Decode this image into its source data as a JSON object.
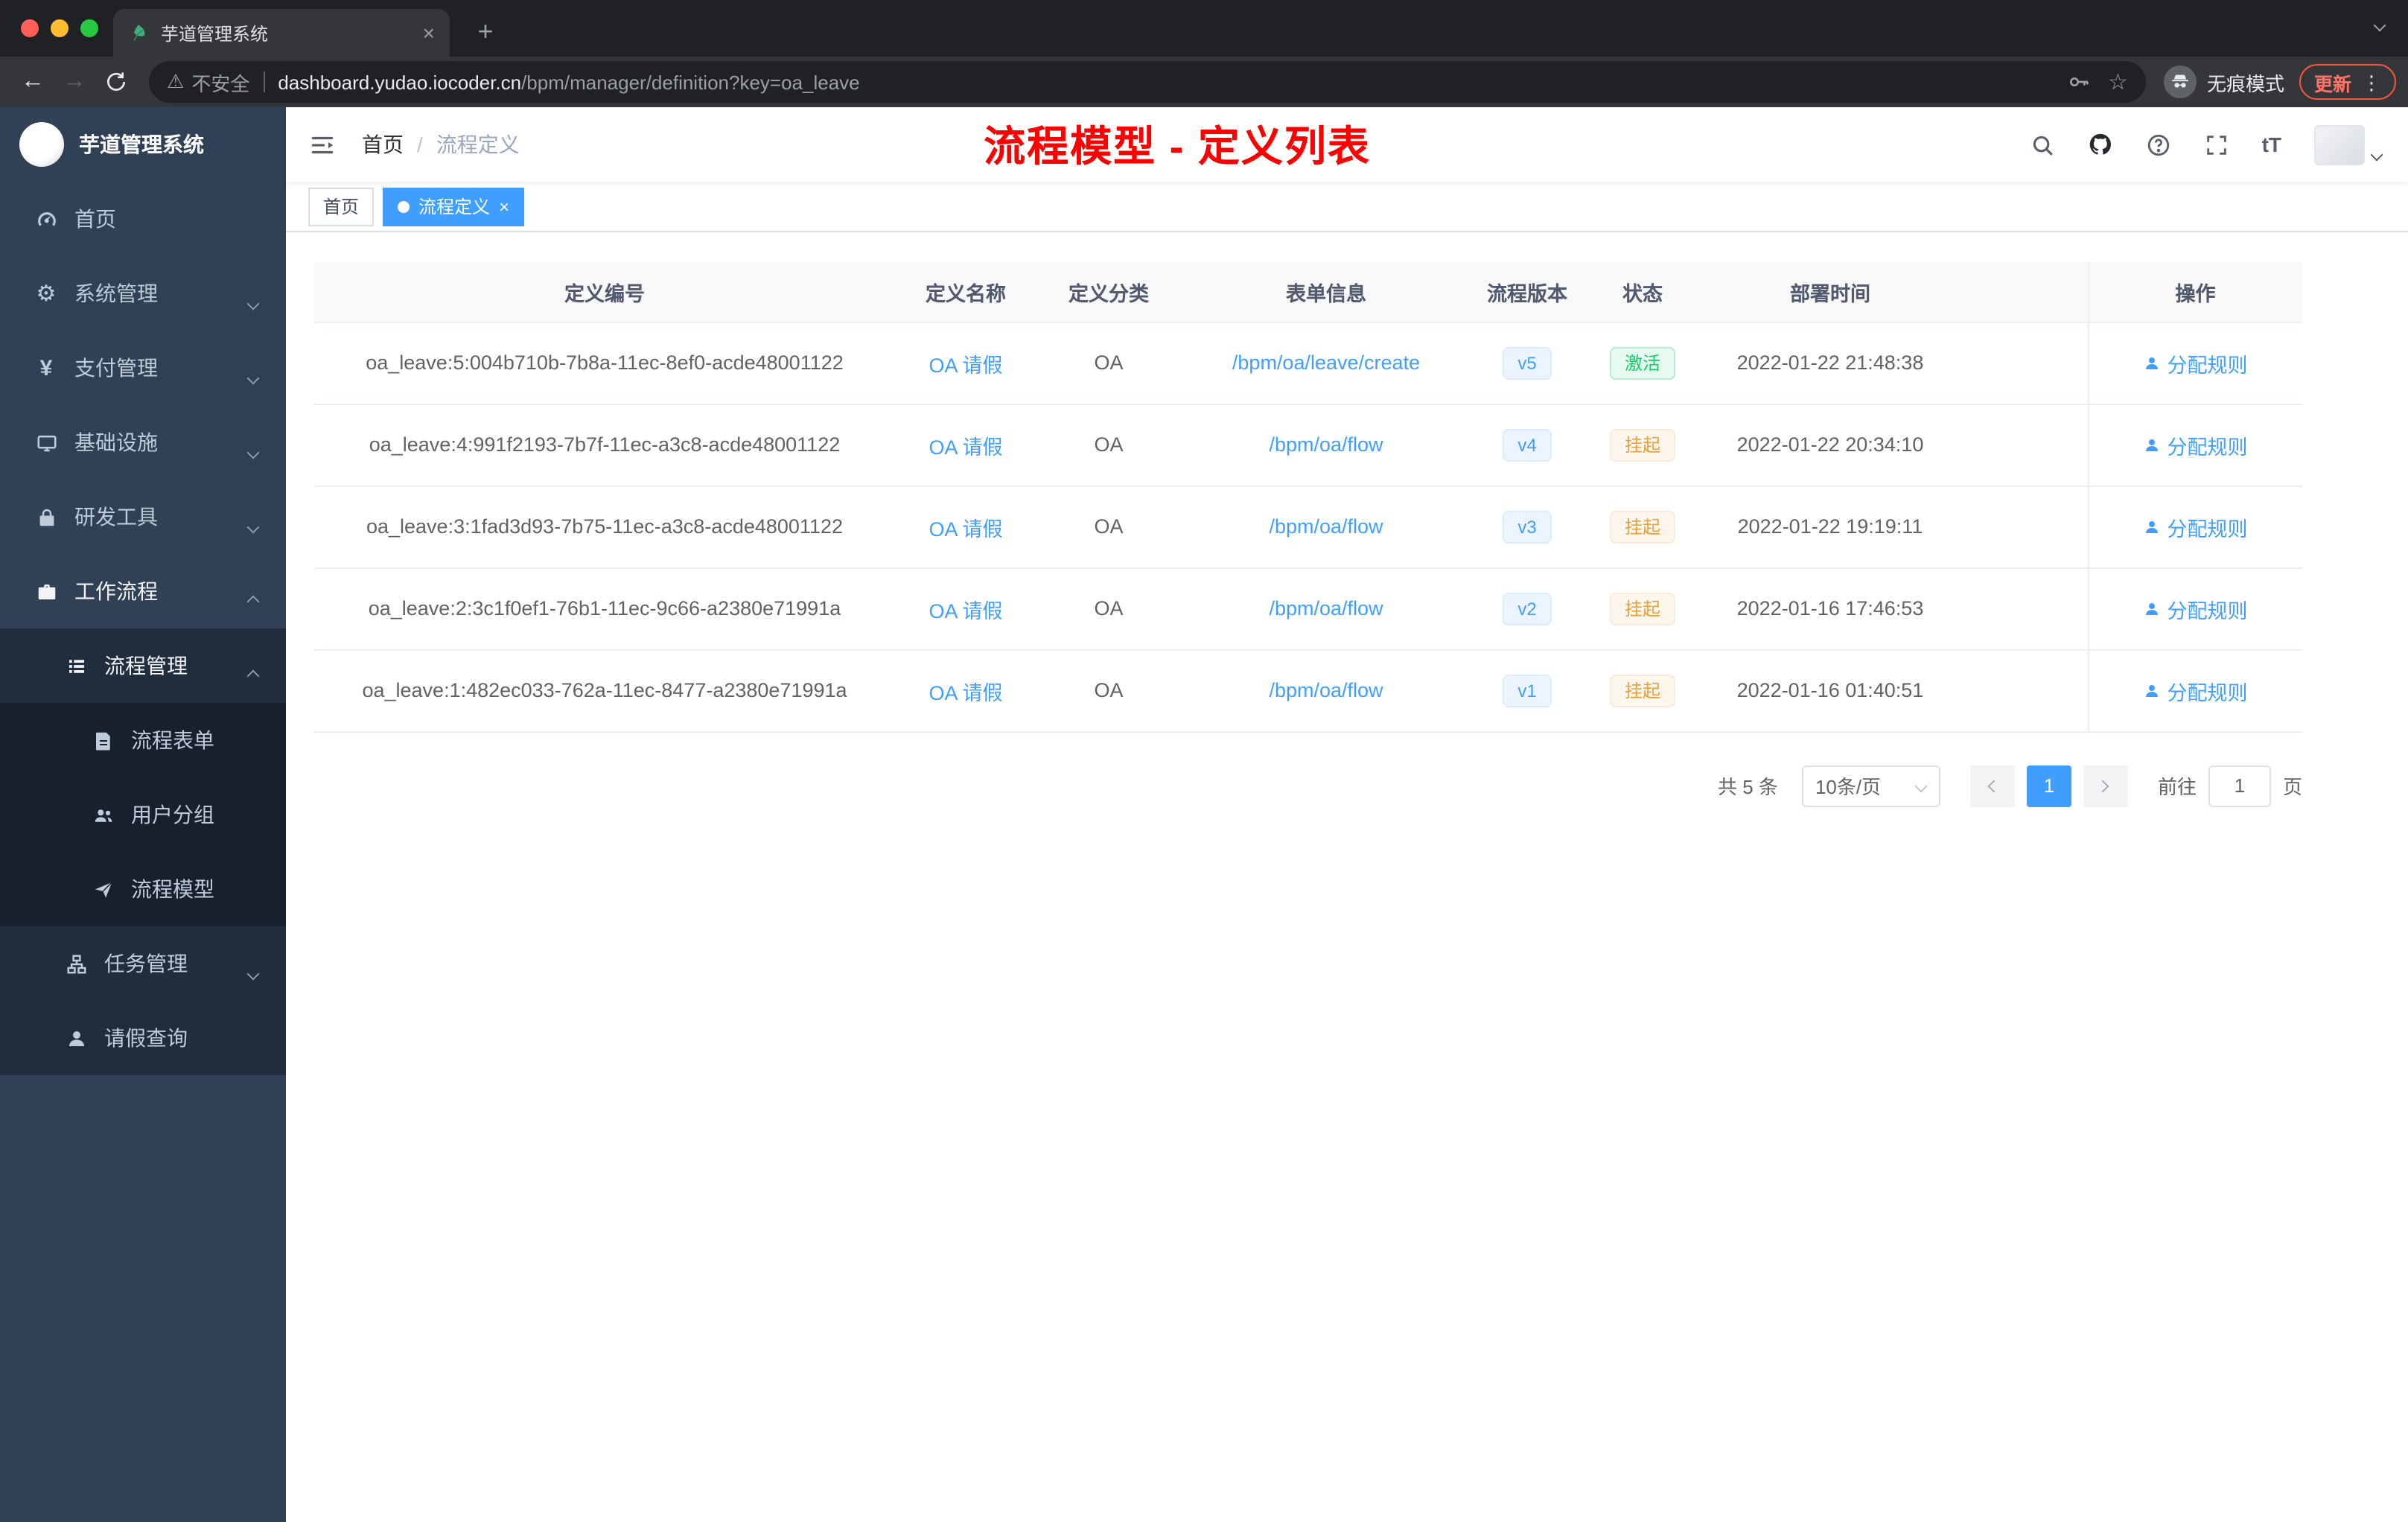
{
  "browser": {
    "tab": {
      "title": "芋道管理系统",
      "close": "×",
      "new_tab": "+"
    },
    "toolbar": {
      "back": "←",
      "forward": "→",
      "security_label": "不安全",
      "warning_glyph": "⚠",
      "url_domain": "dashboard.yudao.iocoder.cn",
      "url_path": "/bpm/manager/definition?key=oa_leave",
      "star": "☆",
      "incognito_label": "无痕模式",
      "update_label": "更新",
      "menu_dots": "⋮"
    }
  },
  "sidebar": {
    "app_title": "芋道管理系统",
    "items": [
      {
        "label": "首页",
        "icon": "dashboard-icon",
        "level": 0,
        "chevron": "none"
      },
      {
        "label": "系统管理",
        "icon": "gear-icon",
        "level": 0,
        "chevron": "down"
      },
      {
        "label": "支付管理",
        "icon": "yen-icon",
        "level": 0,
        "chevron": "down"
      },
      {
        "label": "基础设施",
        "icon": "monitor-icon",
        "level": 0,
        "chevron": "down"
      },
      {
        "label": "研发工具",
        "icon": "lock-icon",
        "level": 0,
        "chevron": "down"
      },
      {
        "label": "工作流程",
        "icon": "briefcase-icon",
        "level": 0,
        "chevron": "up"
      },
      {
        "label": "流程管理",
        "icon": "list-icon",
        "level": 1,
        "chevron": "up"
      },
      {
        "label": "流程表单",
        "icon": "form-icon",
        "level": 2,
        "chevron": "none"
      },
      {
        "label": "用户分组",
        "icon": "group-icon",
        "level": 2,
        "chevron": "none"
      },
      {
        "label": "流程模型",
        "icon": "send-icon",
        "level": 2,
        "chevron": "none"
      },
      {
        "label": "任务管理",
        "icon": "tree-icon",
        "level": 1,
        "chevron": "down"
      },
      {
        "label": "请假查询",
        "icon": "user-icon",
        "level": 1,
        "chevron": "none"
      }
    ],
    "yen_glyph": "¥",
    "gear_glyph": "⚙"
  },
  "navbar": {
    "breadcrumb": {
      "home": "首页",
      "separator": "/",
      "current": "流程定义"
    },
    "annotation": "流程模型 - 定义列表",
    "font_icon": "tT"
  },
  "tags": {
    "home": "首页",
    "active": "流程定义",
    "close": "×"
  },
  "table": {
    "columns": [
      "定义编号",
      "定义名称",
      "定义分类",
      "表单信息",
      "流程版本",
      "状态",
      "部署时间",
      "操作"
    ],
    "rows": [
      {
        "id": "oa_leave:5:004b710b-7b8a-11ec-8ef0-acde48001122",
        "name": "OA 请假",
        "category": "OA",
        "form": "/bpm/oa/leave/create",
        "version": "v5",
        "status": "激活",
        "status_type": "success",
        "deploy_time": "2022-01-22 21:48:38",
        "action": "分配规则"
      },
      {
        "id": "oa_leave:4:991f2193-7b7f-11ec-a3c8-acde48001122",
        "name": "OA 请假",
        "category": "OA",
        "form": "/bpm/oa/flow",
        "version": "v4",
        "status": "挂起",
        "status_type": "warning",
        "deploy_time": "2022-01-22 20:34:10",
        "action": "分配规则"
      },
      {
        "id": "oa_leave:3:1fad3d93-7b75-11ec-a3c8-acde48001122",
        "name": "OA 请假",
        "category": "OA",
        "form": "/bpm/oa/flow",
        "version": "v3",
        "status": "挂起",
        "status_type": "warning",
        "deploy_time": "2022-01-22 19:19:11",
        "action": "分配规则"
      },
      {
        "id": "oa_leave:2:3c1f0ef1-76b1-11ec-9c66-a2380e71991a",
        "name": "OA 请假",
        "category": "OA",
        "form": "/bpm/oa/flow",
        "version": "v2",
        "status": "挂起",
        "status_type": "warning",
        "deploy_time": "2022-01-16 17:46:53",
        "action": "分配规则"
      },
      {
        "id": "oa_leave:1:482ec033-762a-11ec-8477-a2380e71991a",
        "name": "OA 请假",
        "category": "OA",
        "form": "/bpm/oa/flow",
        "version": "v1",
        "status": "挂起",
        "status_type": "warning",
        "deploy_time": "2022-01-16 01:40:51",
        "action": "分配规则"
      }
    ]
  },
  "pagination": {
    "total": "共 5 条",
    "page_size": "10条/页",
    "page": "1",
    "goto_label": "前往",
    "goto_value": "1",
    "goto_unit": "页"
  },
  "colors": {
    "accent": "#409eff",
    "annotation_red": "#fe0000",
    "success_green": "#13ce66",
    "warning_orange": "#e6a23c",
    "sidebar_bg": "#304156",
    "submenu_bg": "#1f2d3d",
    "chrome_dark": "#202124",
    "chrome_toolbar": "#35363a"
  }
}
